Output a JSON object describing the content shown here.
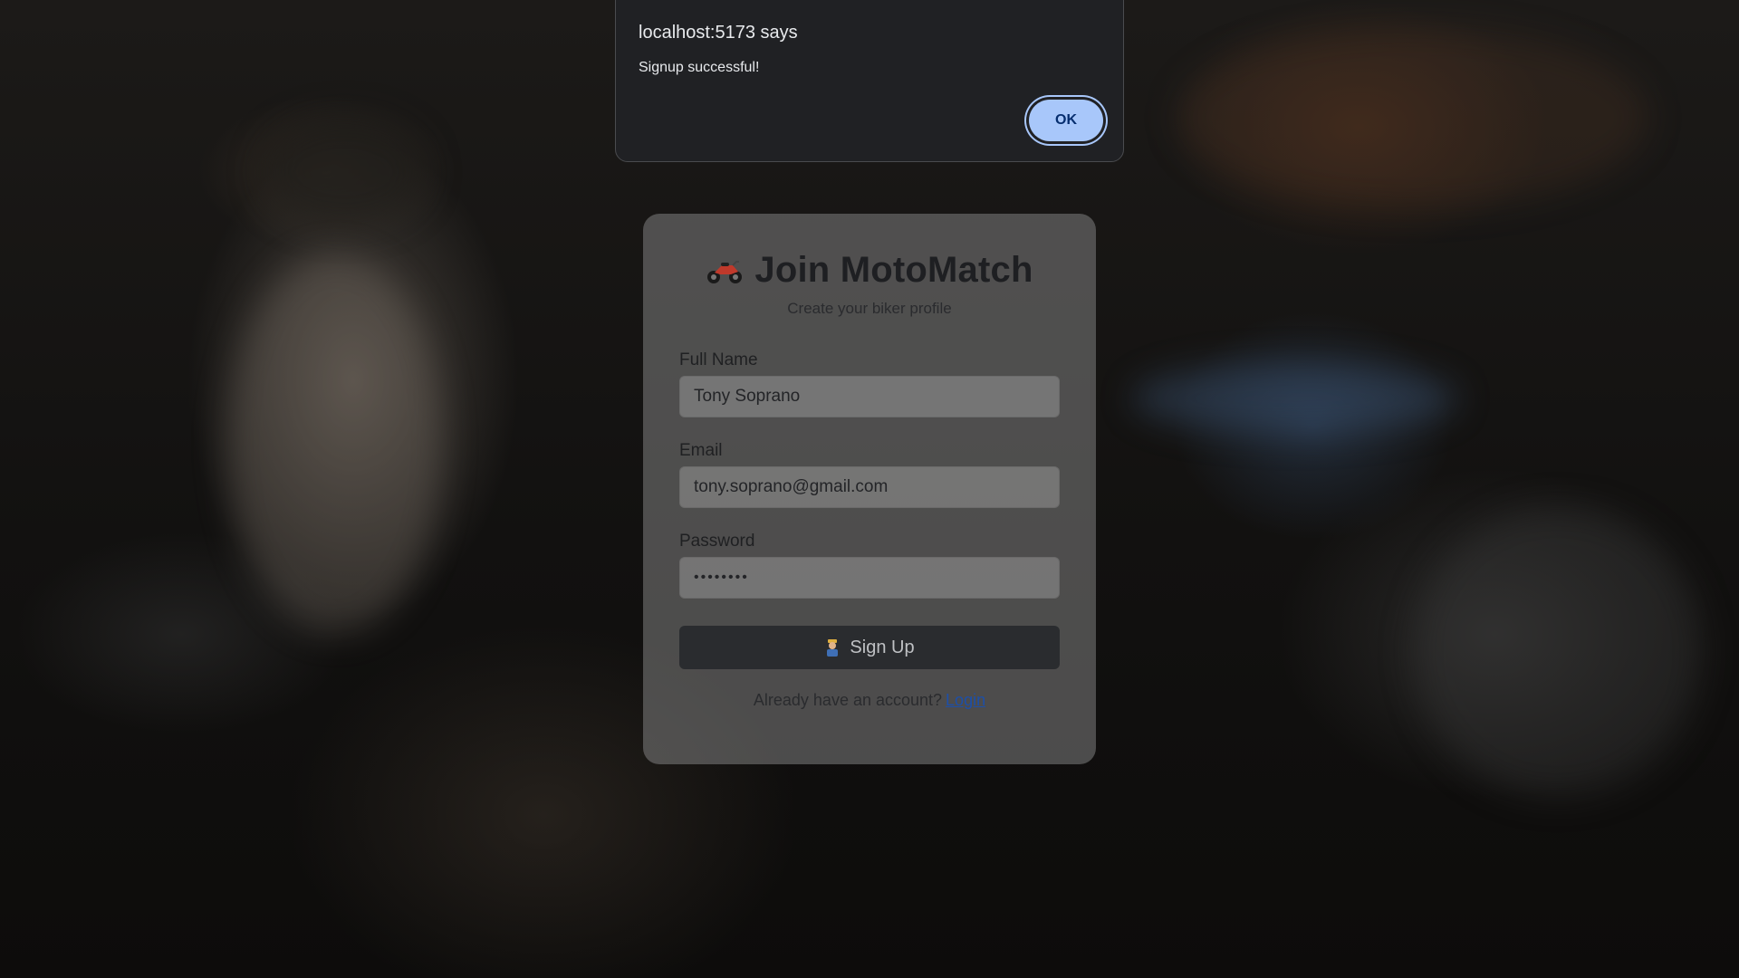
{
  "dialog": {
    "title": "localhost:5173 says",
    "message": "Signup successful!",
    "ok_label": "OK"
  },
  "card": {
    "icon": "motorcycle-icon",
    "title": "Join MotoMatch",
    "subtitle": "Create your biker profile",
    "fields": {
      "name_label": "Full Name",
      "name_value": "Tony Soprano",
      "email_label": "Email",
      "email_value": "tony.soprano@gmail.com",
      "password_label": "Password",
      "password_value": "••••••••"
    },
    "signup_icon": "mechanic-icon",
    "signup_label": "Sign Up",
    "footer_text": "Already have an account?",
    "login_link": "Login"
  },
  "colors": {
    "ok_button_bg": "#a8c7fa",
    "dialog_bg": "#202124",
    "signup_button_bg": "#2a2c2f",
    "link": "#1d4fa8"
  }
}
